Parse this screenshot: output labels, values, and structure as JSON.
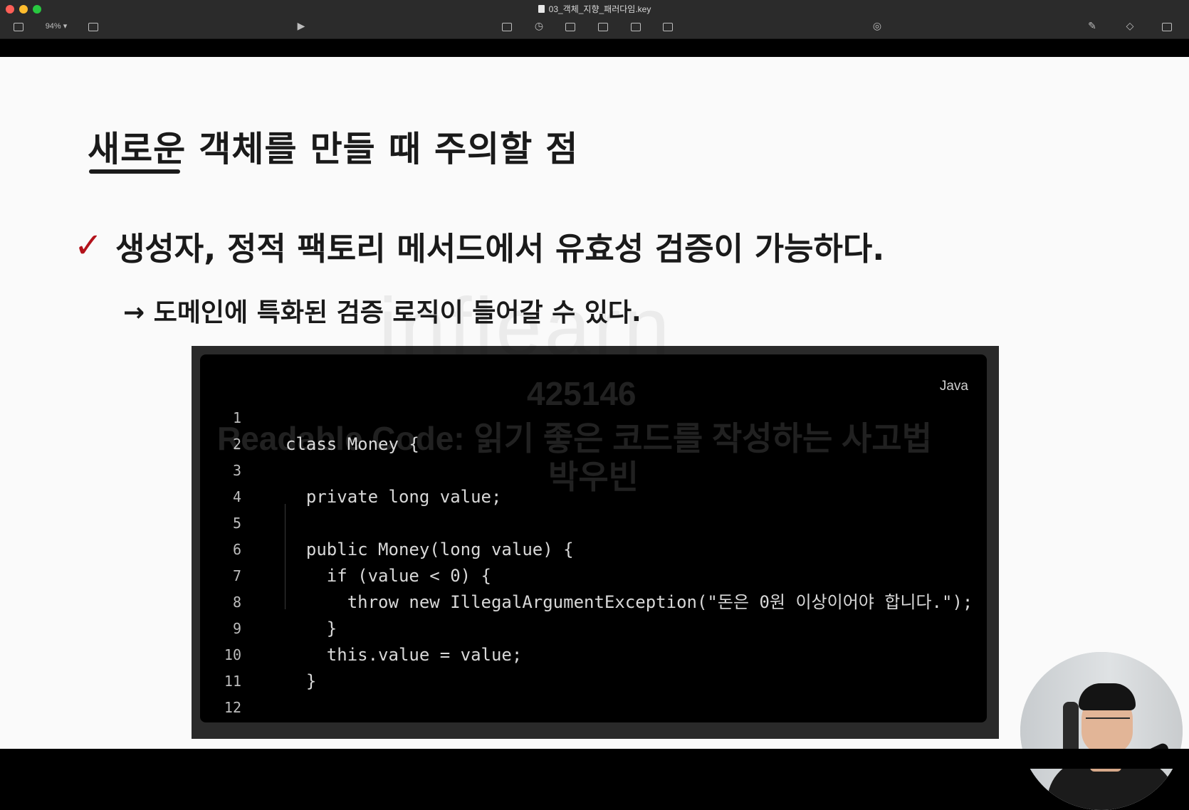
{
  "window": {
    "document_title": "03_객체_지향_패러다임.key",
    "zoom_level": "94%"
  },
  "toolbar": {
    "icons": [
      "sidebar-icon",
      "zoom-dropdown",
      "add-slide-icon",
      "play-icon",
      "table-icon",
      "chart-icon",
      "text-icon",
      "shape-icon",
      "media-icon",
      "comment-icon",
      "collaborate-icon",
      "format-icon",
      "animate-icon",
      "document-icon"
    ]
  },
  "slide": {
    "title": "새로운 객체를 만들 때 주의할 점",
    "check_mark": "✓",
    "point": "생성자, 정적 팩토리 메서드에서 유효성 검증이 가능하다.",
    "subpoint": "→ 도메인에 특화된 검증 로직이 들어갈 수 있다.",
    "code": {
      "language": "Java",
      "lines": [
        {
          "n": "1",
          "text": "class Money {"
        },
        {
          "n": "2",
          "text": ""
        },
        {
          "n": "3",
          "text": "  private long value;"
        },
        {
          "n": "4",
          "text": ""
        },
        {
          "n": "5",
          "text": "  public Money(long value) {"
        },
        {
          "n": "6",
          "text": "    if (value < 0) {"
        },
        {
          "n": "7",
          "text": "      throw new IllegalArgumentException(\"돈은 0원 이상이어야 합니다.\");"
        },
        {
          "n": "8",
          "text": "    }"
        },
        {
          "n": "9",
          "text": "    this.value = value;"
        },
        {
          "n": "10",
          "text": "  }"
        },
        {
          "n": "11",
          "text": ""
        },
        {
          "n": "12",
          "text": "}"
        }
      ]
    }
  },
  "watermark": {
    "logo": "inflearn",
    "id": "425146",
    "course": "Readable Code: 읽기 좋은 코드를 작성하는 사고법",
    "author": "박우빈"
  },
  "colors": {
    "check_red": "#b3121b",
    "code_bg": "#000000",
    "frame_bg": "#2a2a2a"
  }
}
